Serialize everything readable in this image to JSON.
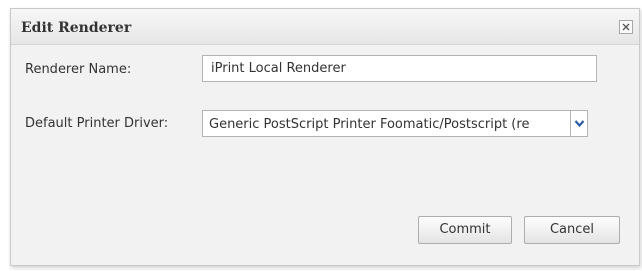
{
  "dialog": {
    "title": "Edit Renderer",
    "close_icon": "close-icon"
  },
  "form": {
    "renderer_name": {
      "label": "Renderer Name:",
      "value": "iPrint Local Renderer"
    },
    "default_driver": {
      "label": "Default Printer Driver:",
      "selected": "Generic PostScript Printer Foomatic/Postscript (re",
      "arrow_icon": "chevron-down-icon"
    }
  },
  "buttons": {
    "commit_label": "Commit",
    "cancel_label": "Cancel"
  },
  "colors": {
    "dialog_bg": "#f2f2f2",
    "titlebar_bg": "#e9e9e9",
    "text": "#333333",
    "border": "#b3b3b3",
    "arrow": "#2b5ca8"
  }
}
